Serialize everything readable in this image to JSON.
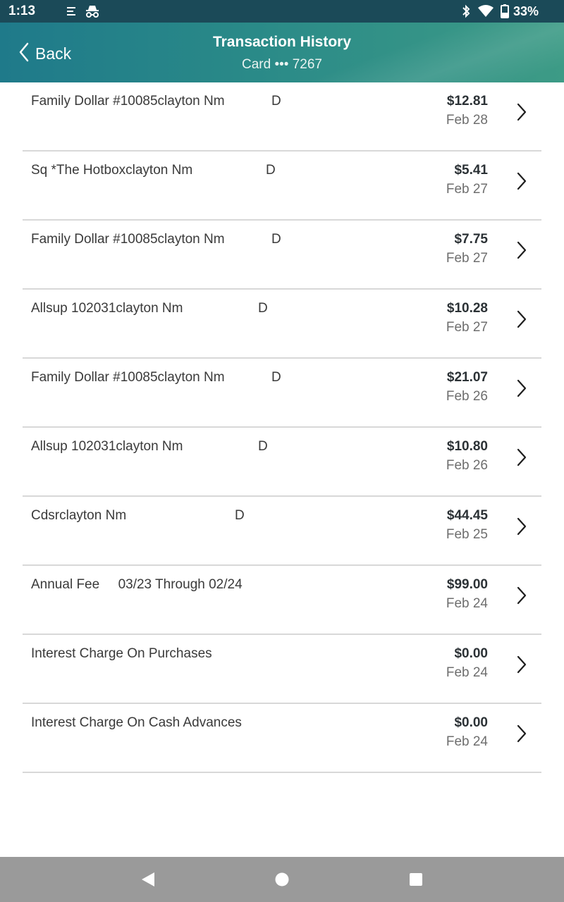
{
  "status_bar": {
    "time": "1:13",
    "battery": "33%",
    "icons": [
      "notes-icon",
      "incognito-icon",
      "bluetooth-icon",
      "wifi-icon",
      "battery-icon"
    ]
  },
  "header": {
    "back_label": "Back",
    "title": "Transaction History",
    "subtitle": "Card ••• 7267"
  },
  "transactions": [
    {
      "description": "Family Dollar #10085clayton Nm",
      "flag": "D",
      "amount": "$12.81",
      "date": "Feb 28"
    },
    {
      "description": "Sq *The Hotboxclayton Nm",
      "flag": "D",
      "amount": "$5.41",
      "date": "Feb 27"
    },
    {
      "description": "Family Dollar #10085clayton Nm",
      "flag": "D",
      "amount": "$7.75",
      "date": "Feb 27"
    },
    {
      "description": "Allsup 102031clayton Nm",
      "flag": "D",
      "amount": "$10.28",
      "date": "Feb 27"
    },
    {
      "description": "Family Dollar #10085clayton Nm",
      "flag": "D",
      "amount": "$21.07",
      "date": "Feb 26"
    },
    {
      "description": "Allsup 102031clayton Nm",
      "flag": "D",
      "amount": "$10.80",
      "date": "Feb 26"
    },
    {
      "description": "Cdsrclayton Nm",
      "flag": "D",
      "amount": "$44.45",
      "date": "Feb 25"
    },
    {
      "description": "Annual Fee     03/23 Through 02/24",
      "flag": "",
      "amount": "$99.00",
      "date": "Feb 24"
    },
    {
      "description": "Interest Charge On Purchases",
      "flag": "",
      "amount": "$0.00",
      "date": "Feb 24"
    },
    {
      "description": "Interest Charge On Cash Advances",
      "flag": "",
      "amount": "$0.00",
      "date": "Feb 24"
    }
  ],
  "nav": {
    "icons": [
      "back-triangle-icon",
      "home-circle-icon",
      "recents-square-icon"
    ]
  },
  "colors": {
    "status_bar": "#1b4a58",
    "header_start": "#1f7a8a",
    "header_end": "#3d9b86",
    "nav_bar": "#9a9a9a",
    "divider": "#d8d8d8"
  }
}
